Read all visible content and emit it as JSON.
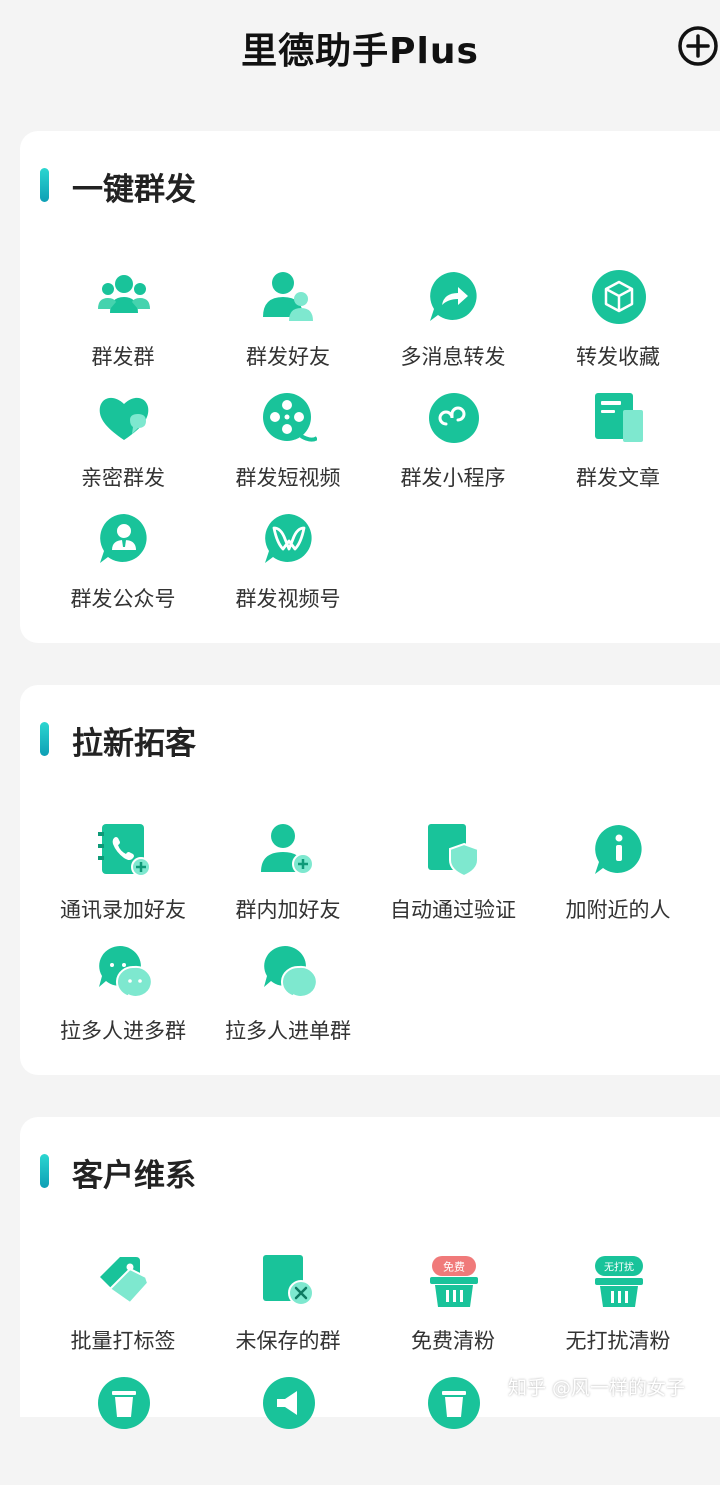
{
  "header": {
    "title": "里德助手Plus"
  },
  "sections": [
    {
      "title": "一键群发",
      "items": [
        {
          "label": "群发群",
          "icon": "group-chat-icon"
        },
        {
          "label": "群发好友",
          "icon": "friends-icon"
        },
        {
          "label": "多消息转发",
          "icon": "forward-icon"
        },
        {
          "label": "转发收藏",
          "icon": "favorite-cube-icon"
        },
        {
          "label": "亲密群发",
          "icon": "heart-chat-icon"
        },
        {
          "label": "群发短视频",
          "icon": "film-reel-icon"
        },
        {
          "label": "群发小程序",
          "icon": "mini-program-icon"
        },
        {
          "label": "群发文章",
          "icon": "article-icon"
        },
        {
          "label": "群发公众号",
          "icon": "official-account-icon"
        },
        {
          "label": "群发视频号",
          "icon": "channels-icon"
        }
      ]
    },
    {
      "title": "拉新拓客",
      "items": [
        {
          "label": "通讯录加好友",
          "icon": "contacts-add-icon"
        },
        {
          "label": "群内加好友",
          "icon": "person-add-icon"
        },
        {
          "label": "自动通过验证",
          "icon": "shield-verify-icon"
        },
        {
          "label": "加附近的人",
          "icon": "nearby-info-icon"
        },
        {
          "label": "拉多人进多群",
          "icon": "multi-group-chat-icon"
        },
        {
          "label": "拉多人进单群",
          "icon": "single-group-chat-icon"
        }
      ]
    },
    {
      "title": "客户维系",
      "items": [
        {
          "label": "批量打标签",
          "icon": "tag-icon"
        },
        {
          "label": "未保存的群",
          "icon": "unsaved-group-icon"
        },
        {
          "label": "免费清粉",
          "icon": "free-clean-icon",
          "badge": "免费"
        },
        {
          "label": "无打扰清粉",
          "icon": "silent-clean-icon",
          "badge": "无打扰"
        }
      ]
    }
  ],
  "watermark": "知乎 @风一样的女子",
  "colors": {
    "accent": "#19c39a",
    "accent_light": "#7ee8cf",
    "badge_red": "#f07a7a"
  }
}
